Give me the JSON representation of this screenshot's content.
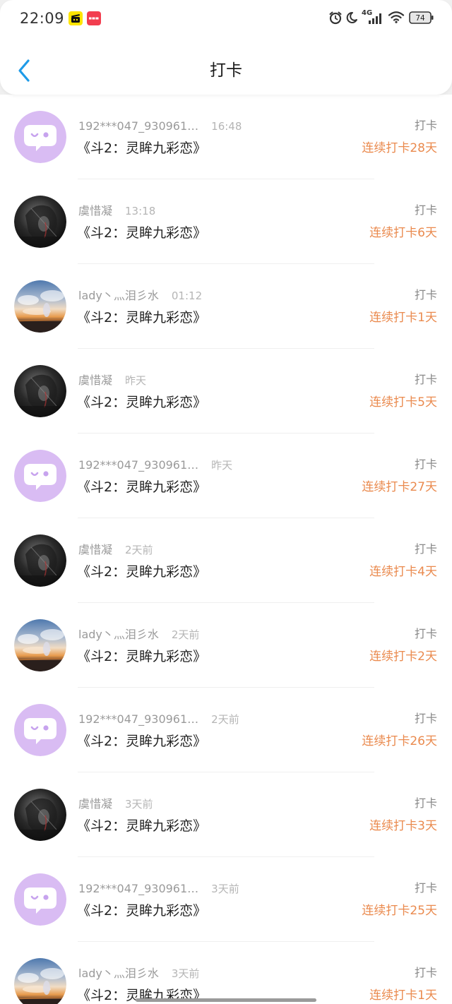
{
  "status_bar": {
    "time": "22:09",
    "network": "4G",
    "battery": "74"
  },
  "header": {
    "back_icon": "chevron-left-icon",
    "title": "打卡"
  },
  "colors": {
    "accent": "#1E9BE8",
    "streak": "#EA8A4E",
    "avatar_default_bg": "#D9BCF3",
    "avatar_default_face": "#C7A3EE"
  },
  "checkins": [
    {
      "avatar": "default-chat-avatar",
      "username": "192***047_930961…",
      "time": "16:48",
      "action": "打卡",
      "book": "《斗2：灵眸九彩恋》",
      "streak": "连续打卡28天"
    },
    {
      "avatar": "dark-anime-avatar",
      "username": "虞惜凝",
      "time": "13:18",
      "action": "打卡",
      "book": "《斗2：灵眸九彩恋》",
      "streak": "连续打卡6天"
    },
    {
      "avatar": "sunset-anime-avatar",
      "username": "lady丶灬泪彡水",
      "time": "01:12",
      "action": "打卡",
      "book": "《斗2：灵眸九彩恋》",
      "streak": "连续打卡1天"
    },
    {
      "avatar": "dark-anime-avatar",
      "username": "虞惜凝",
      "time": "昨天",
      "action": "打卡",
      "book": "《斗2：灵眸九彩恋》",
      "streak": "连续打卡5天"
    },
    {
      "avatar": "default-chat-avatar",
      "username": "192***047_930961…",
      "time": "昨天",
      "action": "打卡",
      "book": "《斗2：灵眸九彩恋》",
      "streak": "连续打卡27天"
    },
    {
      "avatar": "dark-anime-avatar",
      "username": "虞惜凝",
      "time": "2天前",
      "action": "打卡",
      "book": "《斗2：灵眸九彩恋》",
      "streak": "连续打卡4天"
    },
    {
      "avatar": "sunset-anime-avatar",
      "username": "lady丶灬泪彡水",
      "time": "2天前",
      "action": "打卡",
      "book": "《斗2：灵眸九彩恋》",
      "streak": "连续打卡2天"
    },
    {
      "avatar": "default-chat-avatar",
      "username": "192***047_930961…",
      "time": "2天前",
      "action": "打卡",
      "book": "《斗2：灵眸九彩恋》",
      "streak": "连续打卡26天"
    },
    {
      "avatar": "dark-anime-avatar",
      "username": "虞惜凝",
      "time": "3天前",
      "action": "打卡",
      "book": "《斗2：灵眸九彩恋》",
      "streak": "连续打卡3天"
    },
    {
      "avatar": "default-chat-avatar",
      "username": "192***047_930961…",
      "time": "3天前",
      "action": "打卡",
      "book": "《斗2：灵眸九彩恋》",
      "streak": "连续打卡25天"
    },
    {
      "avatar": "sunset-anime-avatar",
      "username": "lady丶灬泪彡水",
      "time": "3天前",
      "action": "打卡",
      "book": "《斗2：灵眸九彩恋》",
      "streak": "连续打卡1天"
    }
  ]
}
